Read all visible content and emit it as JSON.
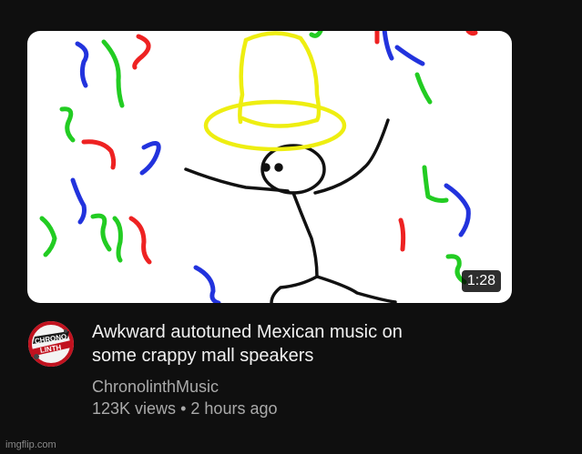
{
  "video": {
    "duration": "1:28",
    "title_line1": "Awkward autotuned Mexican music on",
    "title_line2": "some crappy mall speakers",
    "channel": "ChronolinthMusic",
    "views": "123K views",
    "separator": "•",
    "age": "2 hours ago"
  },
  "avatar": {
    "text_line1": "CHRONO",
    "text_line2": "LINTH"
  },
  "watermark": "imgflip.com",
  "colors": {
    "background": "#0f0f0f",
    "title": "#f1f1f1",
    "secondary": "#aaaaaa",
    "thumbnail_bg": "#ffffff",
    "confetti_blue": "#2233dd",
    "confetti_green": "#22cc22",
    "confetti_red": "#ee2222",
    "hat_yellow": "#eeee11"
  }
}
